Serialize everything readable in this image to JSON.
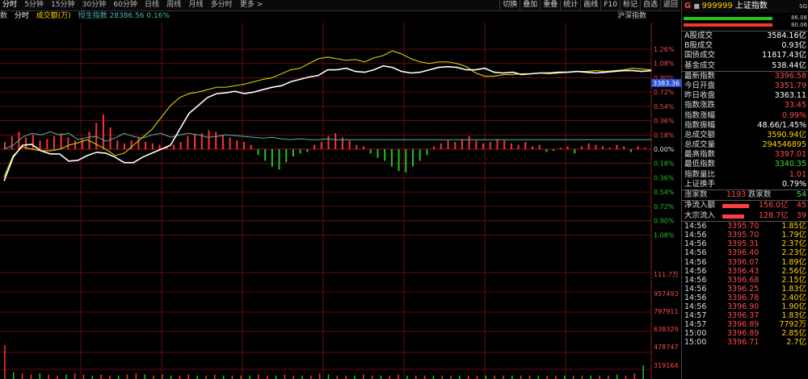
{
  "toolbar": {
    "timeframes": [
      "分时",
      "5分钟",
      "15分钟",
      "30分钟",
      "60分钟",
      "日线",
      "周线",
      "月线",
      "多分时",
      "更多 >"
    ],
    "tools": [
      "切换",
      "叠加",
      "重叠",
      "统计",
      "画线",
      "F10",
      "标记",
      "自选",
      "返回"
    ]
  },
  "legend": {
    "prefix": "数",
    "mode": "分时",
    "volume": "成交额(万)",
    "compare": "恒生指数 28386.56 0.16%",
    "index_name": "沪深指数"
  },
  "chart": {
    "last_price_label": "3383.36",
    "pct_labels_up": [
      "1.26%",
      "1.08%",
      "0.90%",
      "0.72%",
      "0.54%",
      "0.36%",
      "0.18%"
    ],
    "zero_label": "0.00%",
    "pct_labels_down": [
      "0.18%",
      "0.36%",
      "0.54%",
      "0.72%",
      "0.90%",
      "1.08%"
    ],
    "vol_labels": [
      "111.7万",
      "957493",
      "797911",
      "638329",
      "478747",
      "319164"
    ],
    "colors": {
      "up": "#ff3232",
      "down": "#22c222",
      "price": "#ffffff",
      "avg": "#c8c800",
      "cyan": "#4fb4b4",
      "grid": "#7a1010"
    }
  },
  "panel": {
    "g": "G",
    "code": "999999",
    "name": "上证指数",
    "header_icon": "SG",
    "top_bar_values": [
      "86.08",
      "80.06"
    ],
    "rows": [
      {
        "label": "A股成交",
        "value": "3584.16亿",
        "color": "white"
      },
      {
        "label": "B股成交",
        "value": "0.93亿",
        "color": "white"
      },
      {
        "label": "国债成交",
        "value": "11817.43亿",
        "color": "white"
      },
      {
        "label": "基金成交",
        "value": "538.44亿",
        "color": "white"
      },
      {
        "label": "最新指数",
        "value": "3396.58",
        "color": "red"
      },
      {
        "label": "今日开盘",
        "value": "3351.79",
        "color": "red"
      },
      {
        "label": "昨日收盘",
        "value": "3363.11",
        "color": "white"
      },
      {
        "label": "指数涨跌",
        "value": "33.45",
        "color": "red"
      },
      {
        "label": "指数涨幅",
        "value": "0.99%",
        "color": "red"
      },
      {
        "label": "指数振幅",
        "value": "48.66/1.45%",
        "color": "white"
      },
      {
        "label": "总成交额",
        "value": "3590.94亿",
        "color": "yellow"
      },
      {
        "label": "总成交量",
        "value": "294546895",
        "color": "yellow"
      },
      {
        "label": "最高指数",
        "value": "3397.01",
        "color": "red"
      },
      {
        "label": "最低指数",
        "value": "3340.35",
        "color": "green"
      },
      {
        "label": "指数量比",
        "value": "1.01",
        "color": "red"
      },
      {
        "label": "上证换手",
        "value": "0.79%",
        "color": "white"
      }
    ],
    "updown": {
      "up_label": "涨家数",
      "up": "1193",
      "down_label": "跌家数",
      "down": "54"
    },
    "flows": [
      {
        "label": "净流入额",
        "amount": "156.0亿",
        "extra": "45",
        "fill": 0.55
      },
      {
        "label": "大宗流入",
        "amount": "128.7亿",
        "extra": "39",
        "fill": 0.45
      }
    ],
    "ticks": [
      {
        "t": "14:56",
        "p": "3395.70",
        "v": "1.85亿"
      },
      {
        "t": "14:56",
        "p": "3395.70",
        "v": "1.79亿"
      },
      {
        "t": "14:56",
        "p": "3395.31",
        "v": "2.37亿"
      },
      {
        "t": "14:56",
        "p": "3396.40",
        "v": "2.23亿"
      },
      {
        "t": "14:56",
        "p": "3396.07",
        "v": "1.89亿"
      },
      {
        "t": "14:56",
        "p": "3396.43",
        "v": "2.56亿"
      },
      {
        "t": "14:56",
        "p": "3396.68",
        "v": "2.15亿"
      },
      {
        "t": "14:56",
        "p": "3396.25",
        "v": "1.83亿"
      },
      {
        "t": "14:56",
        "p": "3396.78",
        "v": "2.40亿"
      },
      {
        "t": "14:56",
        "p": "3396.90",
        "v": "1.90亿"
      },
      {
        "t": "14:57",
        "p": "3396.37",
        "v": "1.83亿"
      },
      {
        "t": "14:57",
        "p": "3396.89",
        "v": "7792万"
      },
      {
        "t": "15:00",
        "p": "3396.89",
        "v": "2.85亿"
      },
      {
        "t": "15:00",
        "p": "3396.71",
        "v": "2.7亿"
      }
    ]
  },
  "series": {
    "price_pct": [
      -0.4,
      -0.1,
      0.05,
      0.06,
      -0.02,
      -0.06,
      -0.06,
      -0.15,
      -0.14,
      -0.08,
      -0.04,
      -0.05,
      -0.1,
      -0.17,
      -0.17,
      -0.1,
      -0.05,
      0.0,
      0.05,
      0.25,
      0.45,
      0.55,
      0.65,
      0.7,
      0.71,
      0.73,
      0.7,
      0.72,
      0.75,
      0.78,
      0.8,
      0.85,
      0.88,
      0.91,
      0.93,
      1.0,
      1.0,
      1.02,
      0.98,
      0.97,
      1.0,
      1.05,
      1.03,
      0.98,
      0.96,
      0.97,
      1.0,
      1.03,
      1.04,
      1.03,
      1.0,
      1.0,
      1.02,
      0.97,
      0.96,
      0.97,
      0.94,
      0.95,
      0.96,
      0.96,
      0.97,
      0.97,
      0.98,
      0.97,
      0.96,
      0.97,
      0.98,
      0.99,
      0.99,
      0.98,
      0.99
    ],
    "avg_pct": [
      -0.35,
      -0.08,
      0.03,
      0.0,
      -0.02,
      -0.02,
      0.0,
      0.05,
      0.08,
      0.12,
      0.06,
      0.0,
      -0.08,
      -0.05,
      0.05,
      0.15,
      0.25,
      0.4,
      0.55,
      0.65,
      0.7,
      0.72,
      0.75,
      0.78,
      0.78,
      0.8,
      0.82,
      0.85,
      0.88,
      0.9,
      0.95,
      1.0,
      1.02,
      1.08,
      1.14,
      1.16,
      1.14,
      1.12,
      1.13,
      1.1,
      1.15,
      1.18,
      1.24,
      1.2,
      1.14,
      1.1,
      1.08,
      1.1,
      1.1,
      1.08,
      1.04,
      0.96,
      0.92,
      0.92,
      0.94,
      0.94,
      0.95,
      0.95,
      0.96,
      0.95,
      0.96,
      0.97,
      0.98,
      0.98,
      0.99,
      0.98,
      0.99,
      1.0,
      1.02,
      1.01,
      1.0
    ],
    "cyan_pct": [
      0.0,
      0.05,
      0.15,
      0.2,
      0.18,
      0.22,
      0.18,
      0.2,
      0.12,
      0.15,
      0.16,
      0.1,
      0.14,
      0.2,
      0.16,
      0.14,
      0.18,
      0.2,
      0.15,
      0.18,
      0.2,
      0.18,
      0.15,
      0.16,
      0.18,
      0.17,
      0.16,
      0.15,
      0.14,
      0.15,
      0.13,
      0.12,
      0.13,
      0.12,
      0.12,
      0.13,
      0.12,
      0.12,
      0.12,
      0.12,
      0.12,
      0.12,
      0.12,
      0.12,
      0.12,
      0.12,
      0.12,
      0.12,
      0.12,
      0.12,
      0.12,
      0.12,
      0.12,
      0.12,
      0.12,
      0.12,
      0.12,
      0.12,
      0.12,
      0.12,
      0.12,
      0.12,
      0.12,
      0.12,
      0.12,
      0.12,
      0.12,
      0.12,
      0.12,
      0.12,
      0.12
    ],
    "macd": [
      0.5,
      0.9,
      1.2,
      0.8,
      1.0,
      0.6,
      0.7,
      0.9,
      1.1,
      0.8,
      0.6,
      0.7,
      1.2,
      1.8,
      2.4,
      1.5,
      0.6,
      0.4,
      0.6,
      0.8,
      0.5,
      0.4,
      0.3,
      0.2,
      0.3,
      0.5,
      0.9,
      1.0,
      1.1,
      1.3,
      1.2,
      1.0,
      0.8,
      0.6,
      0.5,
      0.3,
      -0.4,
      -0.8,
      -1.2,
      -1.4,
      -0.9,
      -0.5,
      -0.3,
      -0.2,
      0.3,
      0.5,
      0.9,
      1.1,
      0.8,
      0.6,
      0.3,
      0.2,
      -0.3,
      -0.6,
      -0.8,
      -1.2,
      -1.5,
      -1.6,
      -1.2,
      -0.8,
      -0.4,
      0.2,
      0.4,
      0.6,
      0.5,
      0.7,
      0.9,
      0.6,
      0.4,
      0.5,
      0.7,
      0.6,
      0.4,
      0.3,
      0.5,
      0.2,
      0.3,
      -0.2,
      -0.1,
      0.1,
      0.2,
      -0.3,
      0.2,
      0.4,
      0.3,
      0.2,
      0.1,
      0.3,
      0.2,
      -0.2,
      0.2,
      0.1
    ],
    "volume": [
      0.3,
      0.06,
      0.05,
      0.04,
      0.05,
      0.04,
      0.03,
      0.04,
      0.05,
      0.04,
      0.03,
      0.04,
      0.03,
      0.03,
      0.04,
      0.05,
      0.04,
      0.03,
      0.04,
      0.03,
      0.03,
      0.04,
      0.03,
      0.03,
      0.04,
      0.03,
      0.03,
      0.03,
      0.03,
      0.04,
      0.03,
      0.03,
      0.04,
      0.03,
      0.03,
      0.03,
      0.05,
      0.04,
      0.03,
      0.03,
      0.03,
      0.04,
      0.03,
      0.03,
      0.03,
      0.04,
      0.03,
      0.03,
      0.03,
      0.03,
      0.03,
      0.03,
      0.03,
      0.03,
      0.03,
      0.03,
      0.03,
      0.03,
      0.03,
      0.03,
      0.03,
      0.03,
      0.03,
      0.03,
      0.03,
      0.03,
      0.03,
      0.03,
      0.03,
      0.03,
      0.04,
      0.03,
      0.05,
      0.12
    ]
  }
}
